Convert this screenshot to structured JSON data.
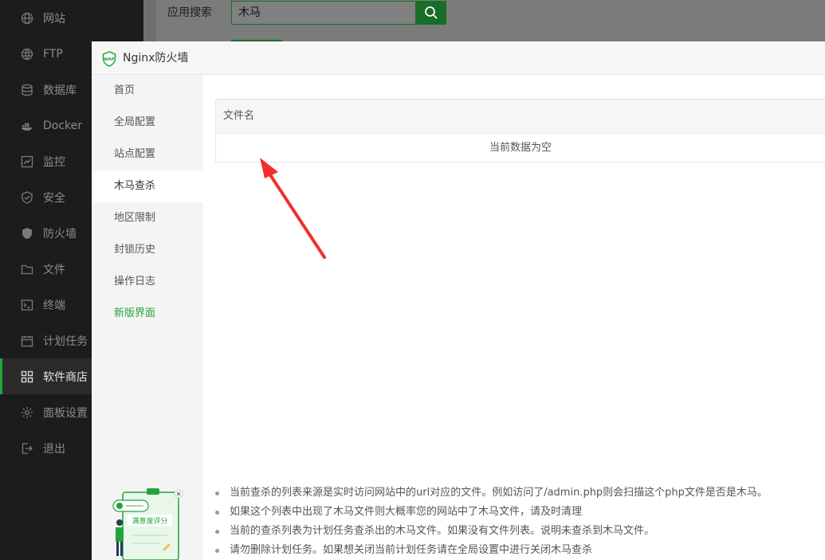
{
  "sidebar": {
    "items": [
      {
        "label": "网站",
        "icon": "globe-icon"
      },
      {
        "label": "FTP",
        "icon": "ftp-globe-icon"
      },
      {
        "label": "数据库",
        "icon": "database-icon"
      },
      {
        "label": "Docker",
        "icon": "docker-icon"
      },
      {
        "label": "监控",
        "icon": "monitor-icon"
      },
      {
        "label": "安全",
        "icon": "shield-check-icon"
      },
      {
        "label": "防火墙",
        "icon": "firewall-shield-icon"
      },
      {
        "label": "文件",
        "icon": "folder-icon"
      },
      {
        "label": "终端",
        "icon": "terminal-icon"
      },
      {
        "label": "计划任务",
        "icon": "calendar-icon"
      },
      {
        "label": "软件商店",
        "icon": "apps-grid-icon",
        "active": true
      },
      {
        "label": "面板设置",
        "icon": "gear-icon"
      },
      {
        "label": "退出",
        "icon": "logout-icon"
      }
    ]
  },
  "search": {
    "label": "应用搜索",
    "value": "木马"
  },
  "modal": {
    "title": "Nginx防火墙",
    "logo_text": "WAF",
    "tabs": [
      {
        "label": "首页"
      },
      {
        "label": "全局配置"
      },
      {
        "label": "站点配置"
      },
      {
        "label": "木马查杀",
        "active": true
      },
      {
        "label": "地区限制"
      },
      {
        "label": "封锁历史"
      },
      {
        "label": "操作日志"
      },
      {
        "label": "新版界面",
        "highlight": true
      }
    ],
    "table": {
      "column_header": "文件名",
      "empty_text": "当前数据为空"
    },
    "notes": [
      "当前查杀的列表来源是实时访问网站中的url对应的文件。例如访问了/admin.php则会扫描这个php文件是否是木马。",
      "如果这个列表中出现了木马文件则大概率您的网站中了木马文件，请及时清理",
      "当前的查杀列表为计划任务查杀出的木马文件。如果没有文件列表。说明未查杀到木马文件。",
      "请勿删除计划任务。如果想关闭当前计划任务请在全局设置中进行关闭木马查杀"
    ],
    "survey_label": "满意度评分"
  },
  "colors": {
    "sidebar_bg": "#1c1c1c",
    "accent_green": "#20a53a",
    "overlay_gray": "#6f6f6f",
    "annotation_red": "#f0302a"
  }
}
